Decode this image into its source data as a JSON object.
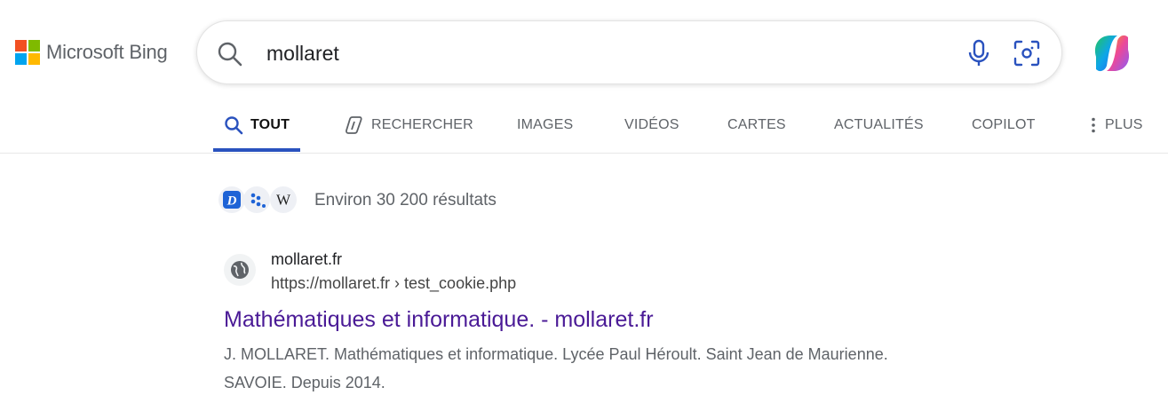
{
  "brand": {
    "name": "Microsoft Bing",
    "colors": [
      "#f25022",
      "#7fba00",
      "#00a4ef",
      "#ffb900"
    ]
  },
  "search": {
    "query": "mollaret",
    "icons": [
      "search-icon",
      "microphone-icon",
      "visual-search-icon"
    ]
  },
  "copilot": {
    "icon": "copilot-icon"
  },
  "tabs": [
    {
      "label": "TOUT",
      "active": true,
      "icon": "search-icon"
    },
    {
      "label": "RECHERCHER",
      "icon": "copilot-search-icon"
    },
    {
      "label": "IMAGES"
    },
    {
      "label": "VIDÉOS"
    },
    {
      "label": "CARTES"
    },
    {
      "label": "ACTUALITÉS"
    },
    {
      "label": "COPILOT"
    },
    {
      "label": "PLUS",
      "icon": "more-icon"
    }
  ],
  "results_meta": {
    "count_text": "Environ 30 200 résultats",
    "source_icons": [
      "dictionary-icon",
      "dots-logo-icon",
      "wikipedia-icon"
    ]
  },
  "results": [
    {
      "site_name": "mollaret.fr",
      "url": "https://mollaret.fr › test_cookie.php",
      "title": "Mathématiques et informatique. - mollaret.fr",
      "snippet_line1": "J. MOLLARET. Mathématiques et informatique. Lycée Paul Héroult. Saint Jean de Maurienne.",
      "snippet_line2": "SAVOIE. Depuis 2014.",
      "favicon": "globe-icon"
    }
  ],
  "accent": "#2a52be",
  "link_color": "#4a1a96"
}
